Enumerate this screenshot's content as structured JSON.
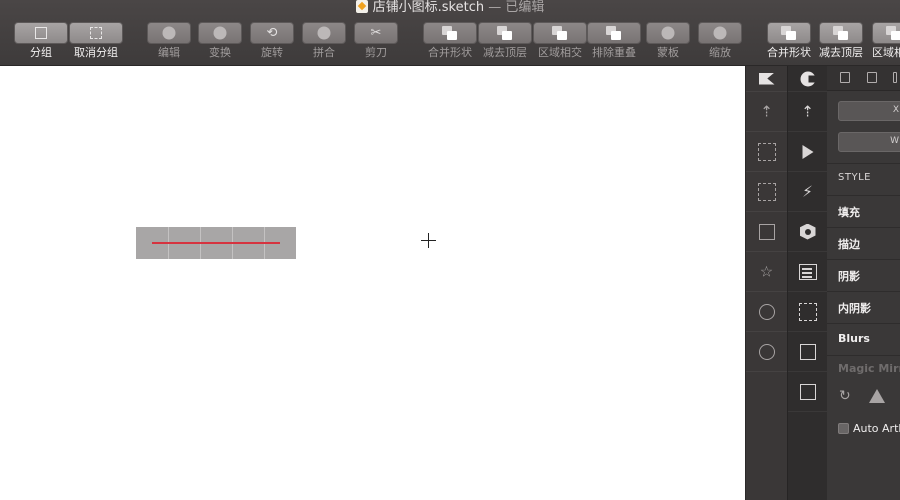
{
  "window": {
    "title": "店铺小图标.sketch",
    "status": "— 已编辑"
  },
  "toolbar": {
    "buttons": [
      {
        "id": "group",
        "label": "分组",
        "icon": "group-icon"
      },
      {
        "id": "ungroup",
        "label": "取消分组",
        "icon": "ungroup-icon"
      },
      {
        "id": "edit",
        "label": "编辑",
        "icon": "edit-icon"
      },
      {
        "id": "transform",
        "label": "变换",
        "icon": "transform-icon"
      },
      {
        "id": "rotate",
        "label": "旋转",
        "icon": "rotate-icon"
      },
      {
        "id": "combine",
        "label": "拼合",
        "icon": "flatten-icon"
      },
      {
        "id": "scissors",
        "label": "剪刀",
        "icon": "scissors-icon"
      },
      {
        "id": "union",
        "label": "合并形状",
        "icon": "union-icon"
      },
      {
        "id": "subtract",
        "label": "减去顶层",
        "icon": "subtract-icon"
      },
      {
        "id": "intersect",
        "label": "区域相交",
        "icon": "intersect-icon"
      },
      {
        "id": "difference",
        "label": "排除重叠",
        "icon": "difference-icon"
      },
      {
        "id": "mask",
        "label": "蒙板",
        "icon": "mask-icon"
      },
      {
        "id": "scale",
        "label": "缩放",
        "icon": "scale-icon"
      },
      {
        "id": "union2",
        "label": "合并形状",
        "icon": "union-icon"
      },
      {
        "id": "subtract2",
        "label": "减去顶层",
        "icon": "subtract-icon"
      },
      {
        "id": "intersect2",
        "label": "区域相",
        "icon": "intersect-icon"
      }
    ]
  },
  "rail_plugins": [
    {
      "icon": "kitchen-logo-icon"
    },
    {
      "icon": "export-icon"
    },
    {
      "icon": "artboard-resize-icon"
    },
    {
      "icon": "layout-grid-icon"
    },
    {
      "icon": "panel-layout-icon"
    },
    {
      "icon": "symbol-star-icon"
    },
    {
      "icon": "palette-icon"
    },
    {
      "icon": "pie-chart-icon"
    }
  ],
  "rail_tools": [
    {
      "icon": "craft-logo-icon"
    },
    {
      "icon": "upload-icon"
    },
    {
      "icon": "prototype-play-icon"
    },
    {
      "icon": "lightning-icon"
    },
    {
      "icon": "library-hex-icon"
    },
    {
      "icon": "data-list-icon"
    },
    {
      "icon": "duplicate-grid-icon"
    },
    {
      "icon": "edit-frame-icon"
    },
    {
      "icon": "add-image-icon"
    }
  ],
  "inspector": {
    "fields": {
      "x_label": "X",
      "w_label": "W"
    },
    "style_header": "STYLE",
    "sections": [
      "填充",
      "描边",
      "阴影",
      "内阴影",
      "Blurs"
    ],
    "magic_mirror": "Magic Mirror",
    "auto_artboard": "Auto Artboard"
  },
  "colors": {
    "toolbar_bg": "#433f3f",
    "selection_fill": "#a8a6a6",
    "guide_line": "#d6333f",
    "inspector_bg": "#3a3838"
  }
}
